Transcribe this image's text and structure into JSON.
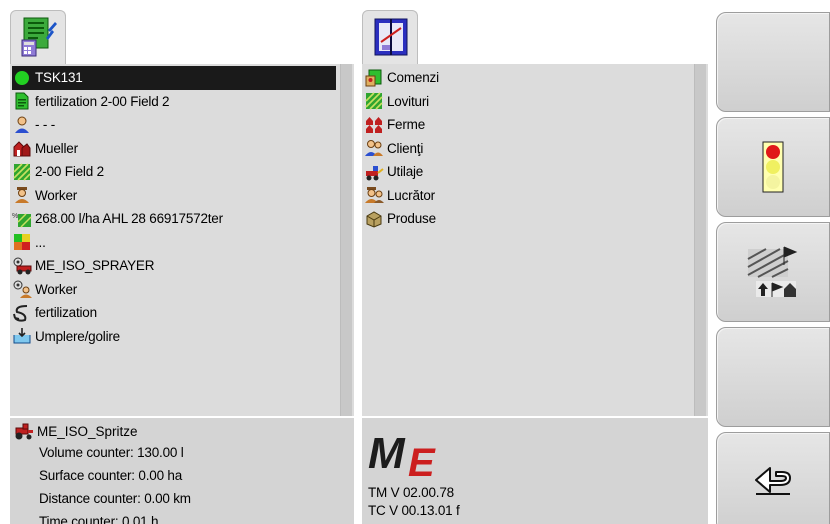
{
  "task_panel": {
    "items": [
      {
        "label": "TSK131",
        "icon": "status-green-dot-icon",
        "selected": true
      },
      {
        "label": "fertilization 2-00 Field 2",
        "icon": "document-icon"
      },
      {
        "label": "- - -",
        "icon": "person-icon"
      },
      {
        "label": "Mueller",
        "icon": "farm-icon"
      },
      {
        "label": "2-00 Field 2",
        "icon": "field-icon"
      },
      {
        "label": "Worker",
        "icon": "worker-icon"
      },
      {
        "label": "268.00 l/ha AHL 28 66917572ter",
        "icon": "product-rate-icon"
      },
      {
        "label": "...",
        "icon": "application-map-icon"
      },
      {
        "label": "ME_ISO_SPRAYER",
        "icon": "machine-icon"
      },
      {
        "label": "Worker",
        "icon": "worker-machine-icon"
      },
      {
        "label": "fertilization",
        "icon": "operation-icon"
      },
      {
        "label": "Umplere/golire",
        "icon": "fill-empty-icon"
      }
    ]
  },
  "library_panel": {
    "items": [
      {
        "label": "Comenzi",
        "icon": "orders-icon"
      },
      {
        "label": "Loviturі",
        "icon": "fields-icon"
      },
      {
        "label": "Ferme",
        "icon": "farms-icon"
      },
      {
        "label": "Clienţi",
        "icon": "customers-icon"
      },
      {
        "label": "Utilaje",
        "icon": "machines-icon"
      },
      {
        "label": "Lucrător",
        "icon": "workers-icon"
      },
      {
        "label": "Produse",
        "icon": "products-icon"
      }
    ]
  },
  "machine_info": {
    "name": "ME_ISO_Spritze",
    "volume": "Volume counter: 130.00 l",
    "surface": "Surface counter: 0.00 ha",
    "distance": "Distance counter: 0.00 km",
    "time": "Time counter: 0.01 h"
  },
  "version_info": {
    "logo": "ME",
    "tm": "TM V 02.00.78",
    "tc": "TC V 00.13.01 f"
  },
  "softkeys": [
    {
      "name": "empty",
      "icon": ""
    },
    {
      "name": "traffic-light",
      "icon": "traffic-light-icon"
    },
    {
      "name": "map-import",
      "icon": "map-import-icon"
    },
    {
      "name": "empty",
      "icon": ""
    },
    {
      "name": "back",
      "icon": "back-arrow-icon"
    }
  ],
  "colors": {
    "selection": "#1a1a1a",
    "status_green": "#22d022",
    "logo_red": "#cc1f1f",
    "logo_dark": "#1c1c1c"
  }
}
